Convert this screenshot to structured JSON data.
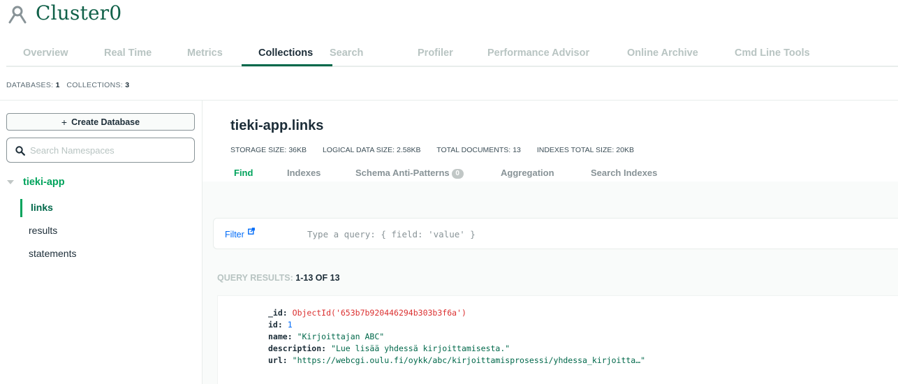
{
  "cluster": {
    "title": "Cluster0"
  },
  "tabs": [
    {
      "label": "Overview"
    },
    {
      "label": "Real Time"
    },
    {
      "label": "Metrics"
    },
    {
      "label": "Collections"
    },
    {
      "label": "Search"
    },
    {
      "label": "Profiler"
    },
    {
      "label": "Performance Advisor"
    },
    {
      "label": "Online Archive"
    },
    {
      "label": "Cmd Line Tools"
    }
  ],
  "active_tab": "Collections",
  "counts": {
    "databases_label": "DATABASES:",
    "databases": "1",
    "collections_label": "COLLECTIONS:",
    "collections": "3"
  },
  "sidebar": {
    "create_label": "Create Database",
    "search_placeholder": "Search Namespaces",
    "database": "tieki-app",
    "collections": [
      "links",
      "results",
      "statements"
    ],
    "active_collection": "links"
  },
  "namespace": {
    "title": "tieki-app.links",
    "stats": [
      {
        "label": "STORAGE SIZE:",
        "value": "36KB"
      },
      {
        "label": "LOGICAL DATA SIZE:",
        "value": "2.58KB"
      },
      {
        "label": "TOTAL DOCUMENTS:",
        "value": "13"
      },
      {
        "label": "INDEXES TOTAL SIZE:",
        "value": "20KB"
      }
    ],
    "subtabs": [
      {
        "label": "Find"
      },
      {
        "label": "Indexes"
      },
      {
        "label": "Schema Anti-Patterns",
        "badge": "0"
      },
      {
        "label": "Aggregation"
      },
      {
        "label": "Search Indexes"
      }
    ]
  },
  "filter": {
    "label": "Filter",
    "placeholder": "Type a query: { field: 'value' }"
  },
  "query_results": {
    "label": "QUERY RESULTS:",
    "range": "1-13 OF 13"
  },
  "document": {
    "fields": [
      {
        "key": "_id:",
        "value": "ObjectId('653b7b920446294b303b3f6a')",
        "kind": "oid"
      },
      {
        "key": "id:",
        "value": "1",
        "kind": "num"
      },
      {
        "key": "name:",
        "value": "\"Kirjoittajan ABC\"",
        "kind": "str"
      },
      {
        "key": "description:",
        "value": "\"Lue lisää yhdessä kirjoittamisesta.\"",
        "kind": "str"
      },
      {
        "key": "url:",
        "value": "\"https://webcgi.oulu.fi/oykk/abc/kirjoittamisprosessi/yhdessa_kirjoitta…\"",
        "kind": "str"
      }
    ]
  },
  "icons": {
    "cluster": "cluster-icon",
    "search": "search-icon",
    "external_link": "external-link-icon",
    "caret": "caret-down-icon"
  },
  "colors": {
    "brand_green": "#00684a",
    "accent_green": "#00a35c",
    "link_blue": "#016bf8",
    "objectid_red": "#db3030"
  }
}
